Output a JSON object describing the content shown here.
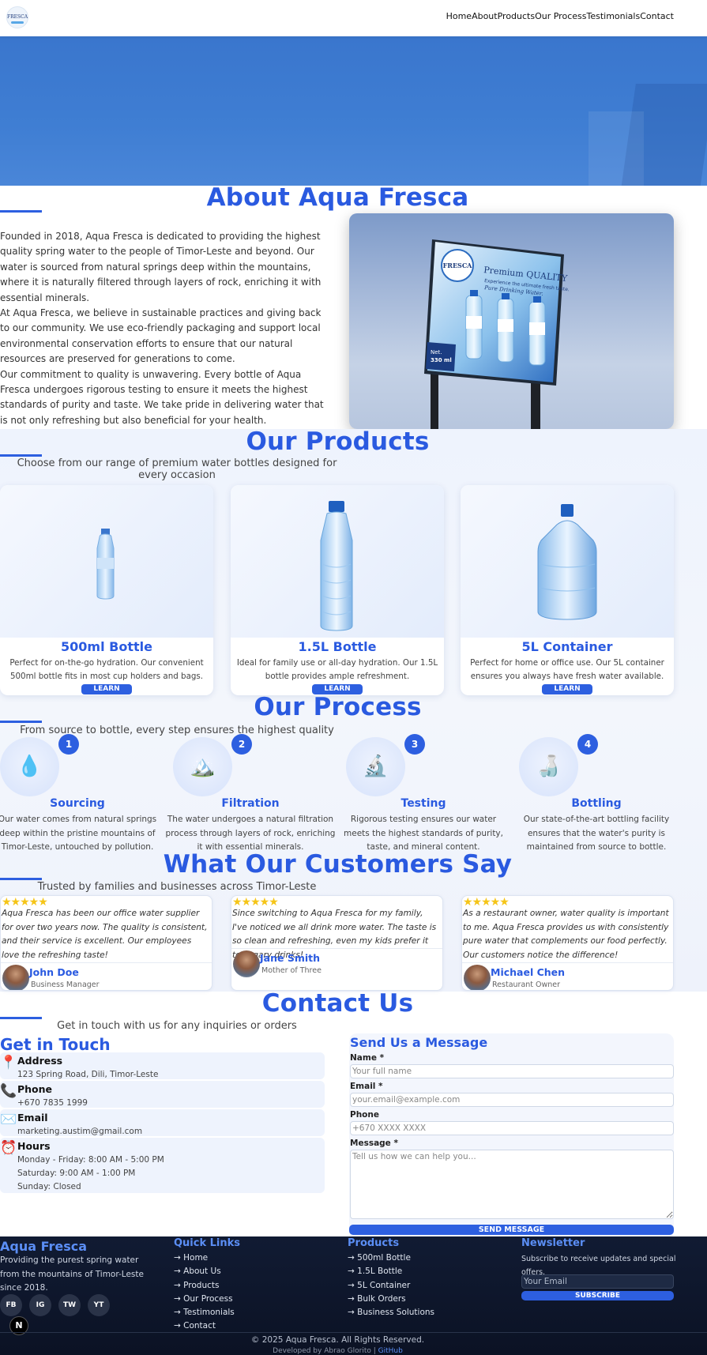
{
  "nav": {
    "logo_text": "FRESCA",
    "items": [
      "Home",
      "About",
      "Products",
      "Our Process",
      "Testimonials",
      "Contact"
    ]
  },
  "about": {
    "title": "About Aqua Fresca",
    "paragraphs": [
      "Founded in 2018, Aqua Fresca is dedicated to providing the highest quality spring water to the people of Timor-Leste and beyond. Our water is sourced from natural springs deep within the mountains, where it is naturally filtered through layers of rock, enriching it with essential minerals.",
      "At Aqua Fresca, we believe in sustainable practices and giving back to our community. We use eco-friendly packaging and support local environmental conservation efforts to ensure that our natural resources are preserved for generations to come.",
      "Our commitment to quality is unwavering. Every bottle of Aqua Fresca undergoes rigorous testing to ensure it meets the highest standards of purity and taste. We take pride in delivering water that is not only refreshing but also beneficial for your health."
    ],
    "billboard": {
      "brand": "FRESCA",
      "headline": "Premium QUALITY",
      "tagline1": "Experience the ultimate fresh taste.",
      "tagline2": "Pure Drinking Water.",
      "net": "Net.",
      "volume": "330 ml"
    }
  },
  "products": {
    "title": "Our Products",
    "subtitle": "Choose from our range of premium water bottles designed for every occasion",
    "items": [
      {
        "name": "500ml Bottle",
        "desc": "Perfect for on-the-go hydration. Our convenient 500ml bottle fits in most cup holders and bags.",
        "button": "LEARN MORE",
        "icon": "small-bottle-image"
      },
      {
        "name": "1.5L Bottle",
        "desc": "Ideal for family use or all-day hydration. Our 1.5L bottle provides ample refreshment.",
        "button": "LEARN MORE",
        "icon": "large-bottle-image"
      },
      {
        "name": "5L Container",
        "desc": "Perfect for home or office use. Our 5L container ensures you always have fresh water available.",
        "button": "LEARN MORE",
        "icon": "container-image"
      }
    ]
  },
  "process": {
    "title": "Our Process",
    "subtitle": "From source to bottle, every step ensures the highest quality",
    "steps": [
      {
        "num": "1",
        "icon": "💧",
        "title": "Sourcing",
        "desc": "Our water comes from natural springs deep within the pristine mountains of Timor-Leste, untouched by pollution."
      },
      {
        "num": "2",
        "icon": "🏔️",
        "title": "Filtration",
        "desc": "The water undergoes a natural filtration process through layers of rock, enriching it with essential minerals."
      },
      {
        "num": "3",
        "icon": "🔬",
        "title": "Testing",
        "desc": "Rigorous testing ensures our water meets the highest standards of purity, taste, and mineral content."
      },
      {
        "num": "4",
        "icon": "🍶",
        "title": "Bottling",
        "desc": "Our state-of-the-art bottling facility ensures that the water's purity is maintained from source to bottle."
      }
    ]
  },
  "testimonials": {
    "title": "What Our Customers Say",
    "subtitle": "Trusted by families and businesses across Timor-Leste",
    "items": [
      {
        "stars": "★★★★★",
        "quote": "Aqua Fresca has been our office water supplier for over two years now. The quality is consistent, and their service is excellent. Our employees love the refreshing taste!",
        "name": "John Doe",
        "role": "Business Manager"
      },
      {
        "stars": "★★★★★",
        "quote": "Since switching to Aqua Fresca for my family, I've noticed we all drink more water. The taste is so clean and refreshing, even my kids prefer it to sugary drinks!",
        "name": "Jane Smith",
        "role": "Mother of Three"
      },
      {
        "stars": "★★★★★",
        "quote": "As a restaurant owner, water quality is important to me. Aqua Fresca provides us with consistently pure water that complements our food perfectly. Our customers notice the difference!",
        "name": "Michael Chen",
        "role": "Restaurant Owner"
      }
    ]
  },
  "contact": {
    "title": "Contact Us",
    "subtitle": "Get in touch with us for any inquiries or orders",
    "info_title": "Get in Touch",
    "address": {
      "label": "Address",
      "value": "123 Spring Road, Dili, Timor-Leste",
      "icon": "📍"
    },
    "phone": {
      "label": "Phone",
      "value": "+670 7835 1999",
      "icon": "📞"
    },
    "email": {
      "label": "Email",
      "value": "marketing.austim@gmail.com",
      "icon": "✉️"
    },
    "hours": {
      "label": "Hours",
      "lines": [
        "Monday - Friday: 8:00 AM - 5:00 PM",
        "Saturday: 9:00 AM - 1:00 PM",
        "Sunday: Closed"
      ],
      "icon": "⏰"
    },
    "form": {
      "title": "Send Us a Message",
      "name_label": "Name *",
      "name_placeholder": "Your full name",
      "email_label": "Email *",
      "email_placeholder": "your.email@example.com",
      "phone_label": "Phone",
      "phone_placeholder": "+670 XXXX XXXX",
      "message_label": "Message *",
      "message_placeholder": "Tell us how we can help you...",
      "submit": "SEND MESSAGE"
    }
  },
  "footer": {
    "brand": "Aqua Fresca",
    "desc": "Providing the purest spring water from the mountains of Timor-Leste since 2018.",
    "social": [
      "FB",
      "IG",
      "TW",
      "YT"
    ],
    "quick_title": "Quick Links",
    "quick_links": [
      "→ Home",
      "→ About Us",
      "→ Products",
      "→ Our Process",
      "→ Testimonials",
      "→ Contact"
    ],
    "products_title": "Products",
    "product_links": [
      "→ 500ml Bottle",
      "→ 1.5L Bottle",
      "→ 5L Container",
      "→ Bulk Orders",
      "→ Business Solutions"
    ],
    "news_title": "Newsletter",
    "news_desc": "Subscribe to receive updates and special offers.",
    "email_placeholder": "Your Email",
    "subscribe": "SUBSCRIBE",
    "copyright": "© 2025 Aqua Fresca. All Rights Reserved.",
    "dev_text": "Developed by Abrao Glorito |",
    "dev_link": "GitHub",
    "badge": "N"
  }
}
